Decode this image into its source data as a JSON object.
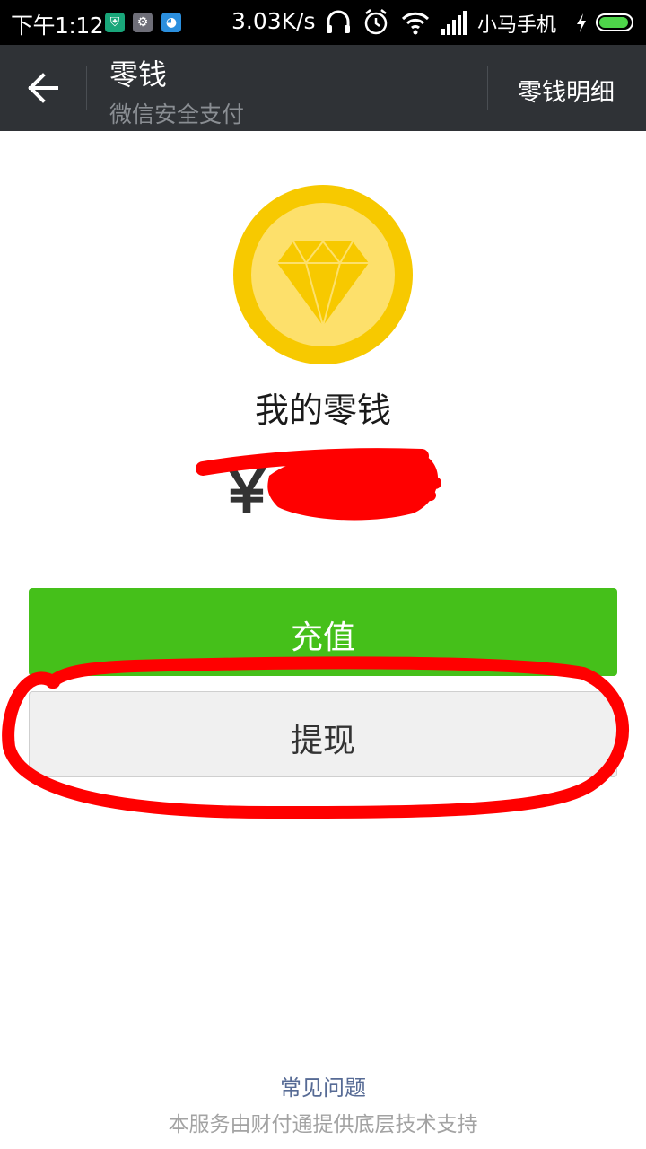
{
  "status_bar": {
    "time": "下午1:12",
    "net_speed": "3.03K/s",
    "carrier": "小马手机",
    "battery_level": 0.95,
    "battery_color": "#4ed54a"
  },
  "action_bar": {
    "title": "零钱",
    "subtitle": "微信安全支付",
    "detail_label": "零钱明细"
  },
  "wallet": {
    "heading": "我的零钱",
    "currency_symbol": "￥",
    "coin_color": "#f7c900"
  },
  "buttons": {
    "recharge_label": "充值",
    "withdraw_label": "提现",
    "accent": "#45c01a"
  },
  "footer": {
    "faq_label": "常见问题",
    "note": "本服务由财付通提供底层技术支持"
  },
  "annotation_color": "#ff0000"
}
